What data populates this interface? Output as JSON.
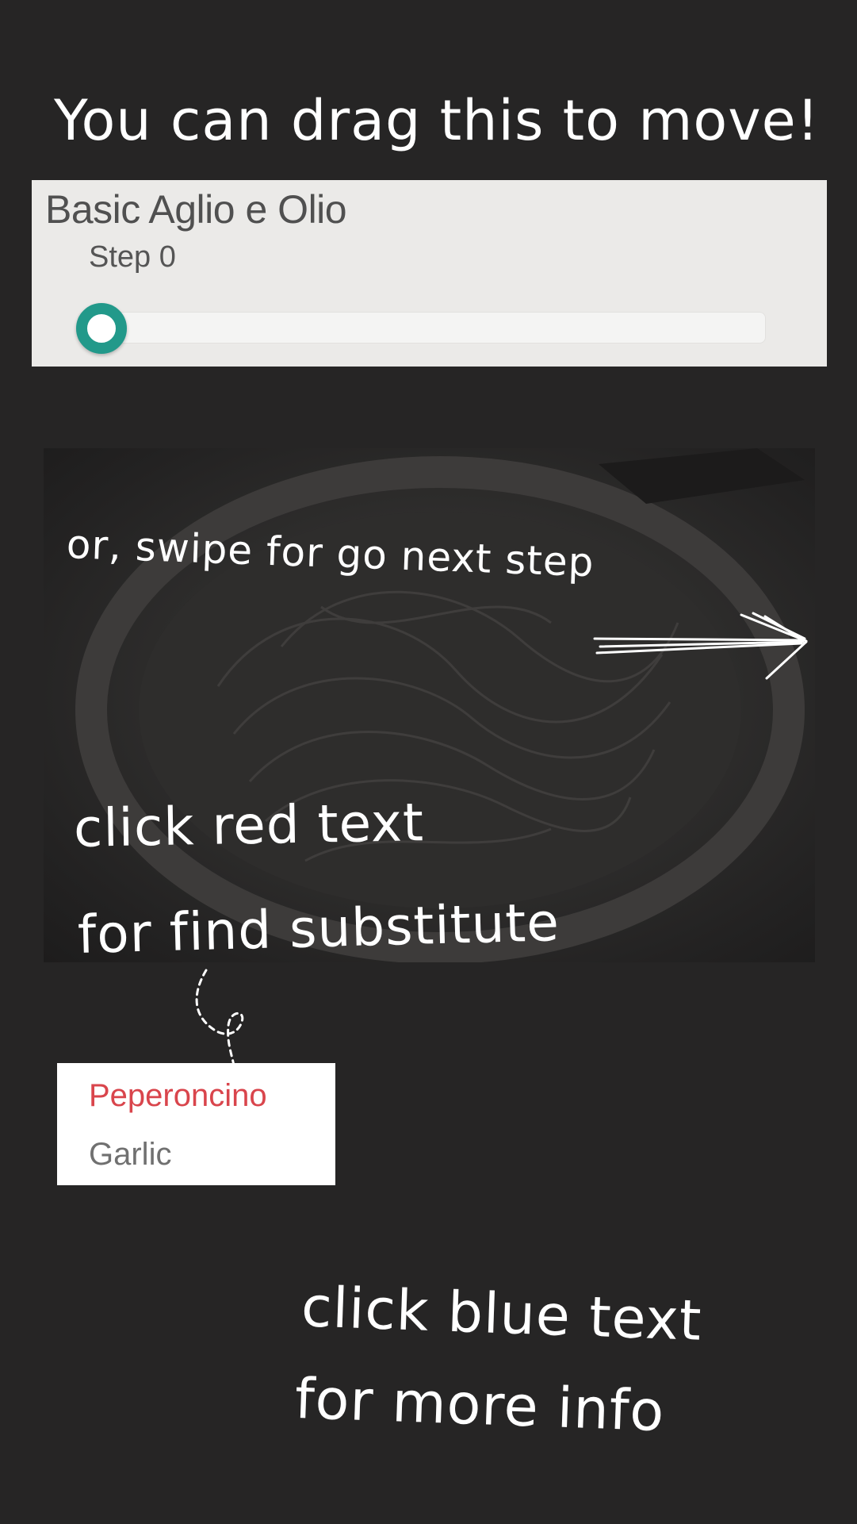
{
  "tutorial": {
    "drag_hint": "You can drag this to move!",
    "swipe_hint": "or, swipe for go next step",
    "red_hint_line1": "click red text",
    "red_hint_line2": "for find substitute",
    "blue_hint_line1": "click blue text",
    "blue_hint_line2": "for more info"
  },
  "recipe": {
    "title": "Basic Aglio e Olio",
    "step_label": "Step 0",
    "step_progress": 0
  },
  "ingredients": [
    {
      "name": "Peperoncino",
      "style": "substitute"
    },
    {
      "name": "Garlic",
      "style": "plain"
    }
  ],
  "icons": {
    "swipe_arrow": "right-arrow-icon",
    "dotted_pointer": "dotted-arrow-icon"
  },
  "colors": {
    "background": "#262525",
    "card": "#ebeae8",
    "slider_accent": "#22998a",
    "substitute_text": "#d9454c",
    "plain_text": "#707070",
    "hint_text": "#ffffff"
  }
}
